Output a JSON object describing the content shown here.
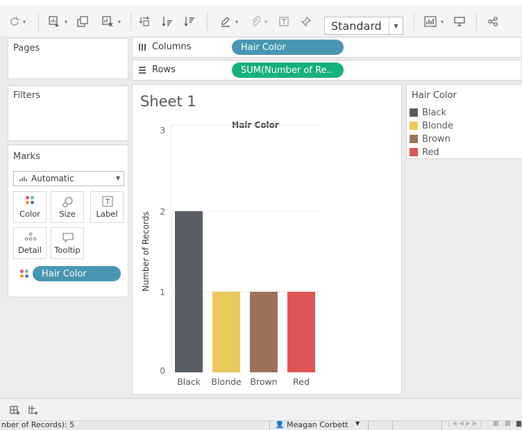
{
  "toolbar": {
    "fit_value": "Standard"
  },
  "panes": {
    "pages_title": "Pages",
    "filters_title": "Filters",
    "marks_title": "Marks",
    "mark_type": "Automatic",
    "mark_buttons": [
      "Color",
      "Size",
      "Label",
      "Detail",
      "Tooltip"
    ],
    "color_pill": "Hair Color"
  },
  "shelves": {
    "columns_label": "Columns",
    "columns_pill": "Hair Color",
    "rows_label": "Rows",
    "rows_pill": "SUM(Number of Re.."
  },
  "sheet": {
    "title": "Sheet 1"
  },
  "legend": {
    "title": "Hair Color",
    "items": [
      {
        "label": "Black",
        "color": "#585c63"
      },
      {
        "label": "Blonde",
        "color": "#ebc85e"
      },
      {
        "label": "Brown",
        "color": "#9c735a"
      },
      {
        "label": "Red",
        "color": "#de5355"
      }
    ]
  },
  "chart_data": {
    "type": "bar",
    "title": "Hair Color",
    "xlabel": "",
    "ylabel": "Number of Records",
    "categories": [
      "Black",
      "Blonde",
      "Brown",
      "Red"
    ],
    "values": [
      2,
      1,
      1,
      1
    ],
    "colors": [
      "#585c63",
      "#ebc85e",
      "#9c735a",
      "#de5355"
    ],
    "yticks": [
      0,
      1,
      2,
      3
    ],
    "ylim": [
      0,
      3
    ],
    "grid": true
  },
  "status": {
    "left": "nber of Records): 5",
    "user": "Meagan Corbett"
  },
  "colors": {
    "pill_blue": "#4996b2",
    "pill_green": "#16b07c"
  }
}
